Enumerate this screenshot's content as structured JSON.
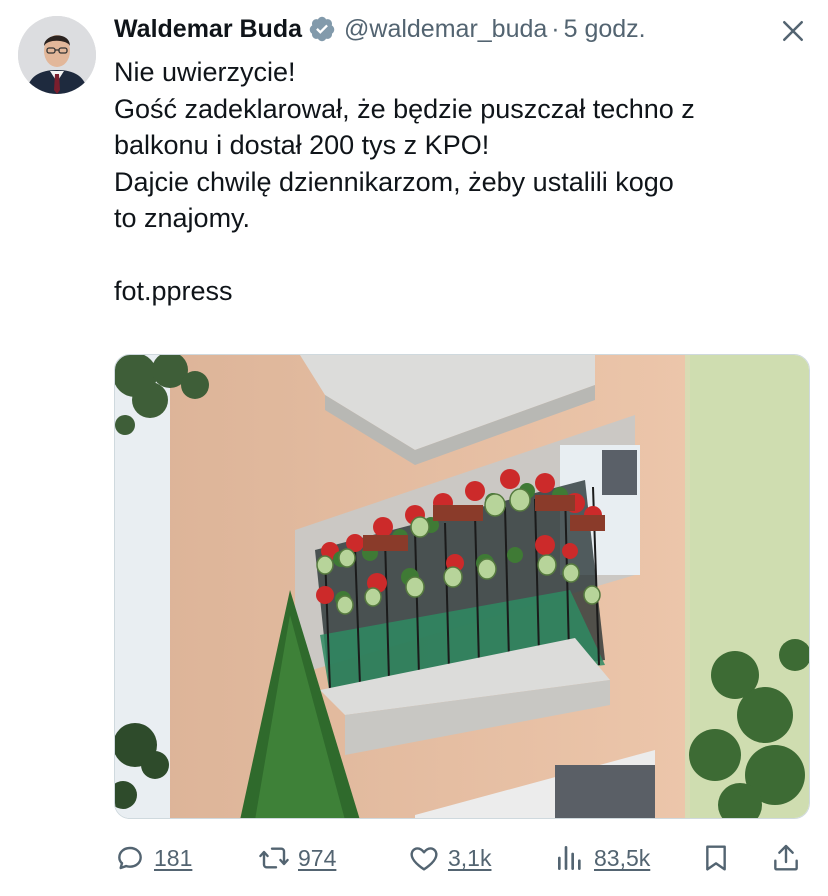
{
  "author": {
    "name": "Waldemar Buda",
    "handle": "@waldemar_buda",
    "separator": "·",
    "time": "5 godz.",
    "verified_color": "#829aab"
  },
  "tweet": {
    "lines": [
      "Nie uwierzycie!",
      "Gość zadeklarował, że będzie puszczał techno z",
      "balkonu i dostał 200 tys z KPO!",
      "Dajcie chwilę dziennikarzom, żeby ustalili kogo",
      "to znajomy.",
      "fot.ppress"
    ]
  },
  "actions": {
    "replies": "181",
    "reposts": "974",
    "likes": "3,1k",
    "views": "83,5k"
  },
  "icons": {
    "close": "close-icon",
    "reply": "reply-icon",
    "repost": "repost-icon",
    "like": "heart-icon",
    "views": "views-icon",
    "bookmark": "bookmark-icon",
    "share": "share-icon"
  },
  "colors": {
    "text": "#0f1419",
    "secondary": "#536471"
  }
}
